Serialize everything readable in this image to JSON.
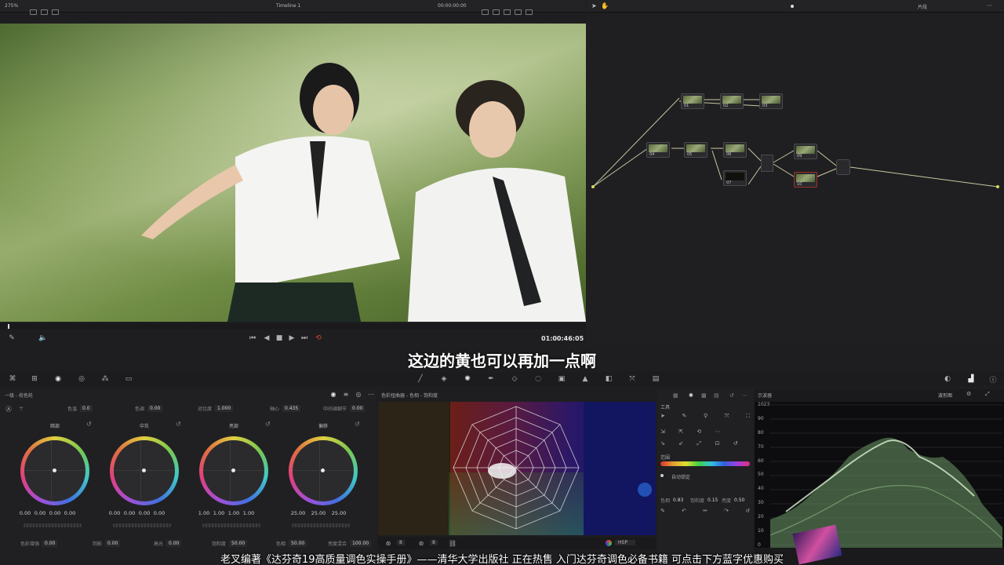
{
  "viewer": {
    "zoom": "275%",
    "timeline_name": "Timeline 1",
    "header_timecode": "00:00:00:00",
    "playhead_timecode": "01:00:46:05"
  },
  "node_editor": {
    "mode_label": "片段",
    "nodes": [
      {
        "label": "01"
      },
      {
        "label": "02"
      },
      {
        "label": "03"
      },
      {
        "label": "04"
      },
      {
        "label": "05"
      },
      {
        "label": "06"
      },
      {
        "label": "07"
      },
      {
        "label": "09"
      },
      {
        "label": "10"
      }
    ]
  },
  "color_wheels": {
    "panel_title": "一级 - 校色轮",
    "top_params": [
      {
        "label": "色温",
        "value": "0.0"
      },
      {
        "label": "色调",
        "value": "0.00"
      },
      {
        "label": "对比度",
        "value": "1.000"
      },
      {
        "label": "轴心",
        "value": "0.435"
      },
      {
        "label": "中间调细节",
        "value": "0.00"
      }
    ],
    "wheels": [
      {
        "name": "暗部",
        "values": [
          "0.00",
          "0.00",
          "0.00",
          "0.00"
        ]
      },
      {
        "name": "中灰",
        "values": [
          "0.00",
          "0.00",
          "0.00",
          "0.00"
        ]
      },
      {
        "name": "亮部",
        "values": [
          "1.00",
          "1.00",
          "1.00",
          "1.00"
        ]
      },
      {
        "name": "偏移",
        "values": [
          "25.00",
          "25.00",
          "25.00"
        ]
      }
    ],
    "bottom_params": [
      {
        "label": "色彩增强",
        "value": "0.00"
      },
      {
        "label": "阴影",
        "value": "0.00"
      },
      {
        "label": "高光",
        "value": "0.00"
      },
      {
        "label": "饱和度",
        "value": "50.00"
      },
      {
        "label": "色相",
        "value": "50.00"
      },
      {
        "label": "亮度混合",
        "value": "100.00"
      }
    ]
  },
  "warper": {
    "panel_title": "色彩扭曲器 - 色相 - 饱和度",
    "control1": "8",
    "control2": "8",
    "mode": "HSP"
  },
  "tools": {
    "title": "工具",
    "range_label": "范围",
    "auto_lock": "自动锁定",
    "params": [
      {
        "label": "色相",
        "value": "0.83"
      },
      {
        "label": "饱和度",
        "value": "0.15"
      },
      {
        "label": "亮度",
        "value": "0.50"
      }
    ]
  },
  "scope": {
    "title": "示波器",
    "mode": "波形图",
    "ticks": [
      "1023",
      "90",
      "80",
      "70",
      "60",
      "50",
      "40",
      "30",
      "20",
      "10",
      "0"
    ]
  },
  "subtitles": {
    "main": "这边的黄也可以再加一点啊",
    "banner": "老叉编著《达芬奇19高质量调色实操手册》——清华大学出版社 正在热售 入门达芬奇调色必备书籍 可点击下方蓝字优惠购买"
  },
  "colors": {
    "accent_red": "#e0442c",
    "scope_trace": "#b8e0b0",
    "node_link": "#c8c8a0"
  }
}
